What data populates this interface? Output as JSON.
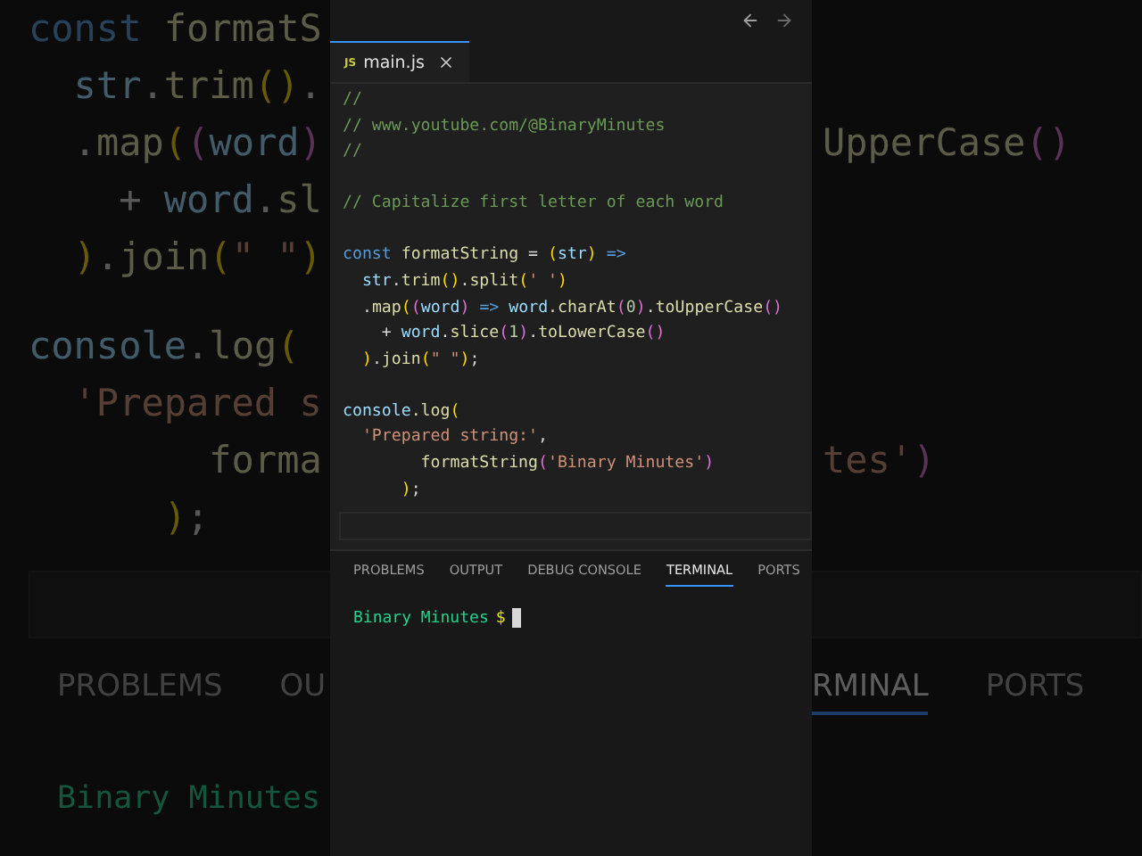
{
  "backdrop": {
    "blocks": [
      {
        "lines": [
          {
            "left": [
              {
                "kind": "kw",
                "text": "const "
              },
              {
                "kind": "fn",
                "text": "formatS"
              }
            ]
          },
          {
            "left": [
              {
                "kind": "var",
                "text": "  str"
              },
              {
                "kind": "op",
                "text": "."
              },
              {
                "kind": "fn",
                "text": "trim"
              },
              {
                "kind": "p1",
                "text": "()"
              },
              {
                "kind": "op",
                "text": "."
              }
            ]
          },
          {
            "left": [
              {
                "kind": "op",
                "text": "  ."
              },
              {
                "kind": "fn",
                "text": "map"
              },
              {
                "kind": "p1",
                "text": "("
              },
              {
                "kind": "p2",
                "text": "("
              },
              {
                "kind": "var",
                "text": "word"
              },
              {
                "kind": "p2",
                "text": ")"
              }
            ],
            "right": [
              {
                "kind": "fn",
                "text": "UpperCase"
              },
              {
                "kind": "p2",
                "text": "()"
              }
            ]
          },
          {
            "left": [
              {
                "kind": "op",
                "text": "    + "
              },
              {
                "kind": "var",
                "text": "word"
              },
              {
                "kind": "op",
                "text": "."
              },
              {
                "kind": "fn",
                "text": "sl"
              }
            ]
          },
          {
            "left": [
              {
                "kind": "p1",
                "text": "  )"
              },
              {
                "kind": "op",
                "text": "."
              },
              {
                "kind": "fn",
                "text": "join"
              },
              {
                "kind": "p1",
                "text": "("
              },
              {
                "kind": "str",
                "text": "\" \""
              },
              {
                "kind": "p1",
                "text": ")"
              }
            ]
          }
        ]
      },
      {
        "lines": [
          {
            "left": [
              {
                "kind": "var",
                "text": "console"
              },
              {
                "kind": "op",
                "text": "."
              },
              {
                "kind": "fn",
                "text": "log"
              },
              {
                "kind": "p1",
                "text": "("
              }
            ]
          },
          {
            "left": [
              {
                "kind": "str",
                "text": "  'Prepared s"
              }
            ]
          },
          {
            "left": [
              {
                "kind": "fn",
                "text": "        forma"
              }
            ],
            "right": [
              {
                "kind": "str",
                "text": "tes'"
              },
              {
                "kind": "p2",
                "text": ")"
              }
            ]
          },
          {
            "left": [
              {
                "kind": "p1",
                "text": "      )"
              },
              {
                "kind": "op",
                "text": ";"
              }
            ]
          }
        ]
      }
    ],
    "tabs_left": [
      {
        "label": "PROBLEMS",
        "selected": false
      },
      {
        "label": "OU",
        "selected": false
      }
    ],
    "tabs_right": [
      {
        "label": "RMINAL",
        "selected": true
      },
      {
        "label": "PORTS",
        "selected": false
      }
    ],
    "terminal_text": "Binary Minutes"
  },
  "editor": {
    "tab": {
      "badge": "JS",
      "label": "main.js",
      "selected": true
    },
    "blocks": [
      {
        "lines": [
          [
            {
              "kind": "cm",
              "text": "//"
            }
          ],
          [
            {
              "kind": "cm",
              "text": "// www.youtube.com/@BinaryMinutes"
            }
          ],
          [
            {
              "kind": "cm",
              "text": "//"
            }
          ]
        ]
      },
      {
        "lines": [
          [
            {
              "kind": "cm",
              "text": "// Capitalize first letter of each word"
            }
          ]
        ]
      },
      {
        "lines": [
          [
            {
              "kind": "kw",
              "text": "const "
            },
            {
              "kind": "fn",
              "text": "formatString"
            },
            {
              "kind": "op",
              "text": " = "
            },
            {
              "kind": "p1",
              "text": "("
            },
            {
              "kind": "var",
              "text": "str"
            },
            {
              "kind": "p1",
              "text": ")"
            },
            {
              "kind": "kw",
              "text": " =>"
            }
          ],
          [
            {
              "kind": "var",
              "text": "  str"
            },
            {
              "kind": "op",
              "text": "."
            },
            {
              "kind": "fn",
              "text": "trim"
            },
            {
              "kind": "p1",
              "text": "()"
            },
            {
              "kind": "op",
              "text": "."
            },
            {
              "kind": "fn",
              "text": "split"
            },
            {
              "kind": "p1",
              "text": "("
            },
            {
              "kind": "str",
              "text": "' '"
            },
            {
              "kind": "p1",
              "text": ")"
            }
          ],
          [
            {
              "kind": "op",
              "text": "  ."
            },
            {
              "kind": "fn",
              "text": "map"
            },
            {
              "kind": "p1",
              "text": "("
            },
            {
              "kind": "p2",
              "text": "("
            },
            {
              "kind": "var",
              "text": "word"
            },
            {
              "kind": "p2",
              "text": ")"
            },
            {
              "kind": "kw",
              "text": " => "
            },
            {
              "kind": "var",
              "text": "word"
            },
            {
              "kind": "op",
              "text": "."
            },
            {
              "kind": "fn",
              "text": "charAt"
            },
            {
              "kind": "p2",
              "text": "("
            },
            {
              "kind": "num",
              "text": "0"
            },
            {
              "kind": "p2",
              "text": ")"
            },
            {
              "kind": "op",
              "text": "."
            },
            {
              "kind": "fn",
              "text": "toUpperCase"
            },
            {
              "kind": "p2",
              "text": "()"
            }
          ],
          [
            {
              "kind": "op",
              "text": "    + "
            },
            {
              "kind": "var",
              "text": "word"
            },
            {
              "kind": "op",
              "text": "."
            },
            {
              "kind": "fn",
              "text": "slice"
            },
            {
              "kind": "p2",
              "text": "("
            },
            {
              "kind": "num",
              "text": "1"
            },
            {
              "kind": "p2",
              "text": ")"
            },
            {
              "kind": "op",
              "text": "."
            },
            {
              "kind": "fn",
              "text": "toLowerCase"
            },
            {
              "kind": "p2",
              "text": "()"
            }
          ],
          [
            {
              "kind": "p1",
              "text": "  )"
            },
            {
              "kind": "op",
              "text": "."
            },
            {
              "kind": "fn",
              "text": "join"
            },
            {
              "kind": "p1",
              "text": "("
            },
            {
              "kind": "str",
              "text": "\" \""
            },
            {
              "kind": "p1",
              "text": ")"
            },
            {
              "kind": "op",
              "text": ";"
            }
          ]
        ]
      },
      {
        "lines": [
          [
            {
              "kind": "var",
              "text": "console"
            },
            {
              "kind": "fn",
              "text": ".log"
            },
            {
              "kind": "p1",
              "text": "("
            }
          ],
          [
            {
              "kind": "str",
              "text": "  'Prepared string:'"
            },
            {
              "kind": "op",
              "text": ","
            }
          ],
          [
            {
              "kind": "fn",
              "text": "        formatString"
            },
            {
              "kind": "p2",
              "text": "("
            },
            {
              "kind": "str",
              "text": "'Binary Minutes'"
            },
            {
              "kind": "p2",
              "text": ")"
            }
          ],
          [
            {
              "kind": "p1",
              "text": "      )"
            },
            {
              "kind": "op",
              "text": ";"
            }
          ]
        ]
      }
    ]
  },
  "panel": {
    "tabs": [
      {
        "label": "PROBLEMS",
        "selected": false
      },
      {
        "label": "OUTPUT",
        "selected": false
      },
      {
        "label": "DEBUG CONSOLE",
        "selected": false
      },
      {
        "label": "TERMINAL",
        "selected": true
      },
      {
        "label": "PORTS",
        "selected": false
      }
    ],
    "prompt": {
      "path": "Binary Minutes",
      "symbol": "$"
    }
  }
}
